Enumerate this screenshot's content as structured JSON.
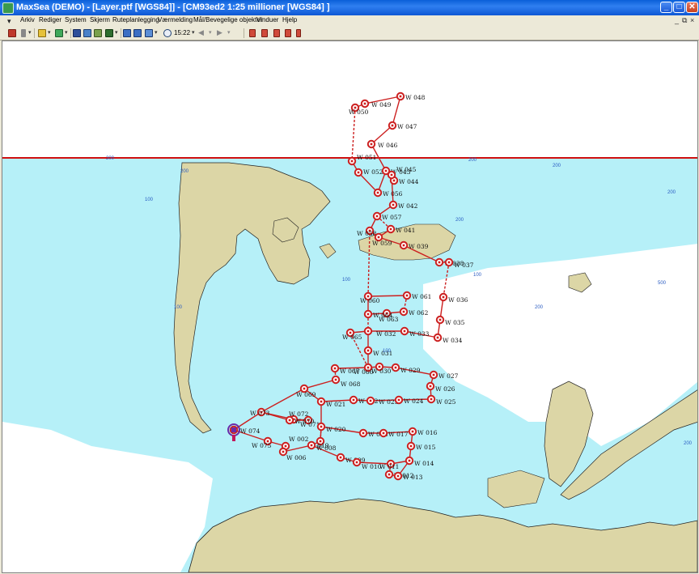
{
  "window": {
    "title": "MaxSea (DEMO) - [Layer.ptf [WGS84]] - [CM93ed2  1:25 millioner [WGS84] ]",
    "minimize_label": "_",
    "maximize_label": "□",
    "close_label": "✕"
  },
  "menu": {
    "items": [
      {
        "label": "Arkiv"
      },
      {
        "label": "Rediger"
      },
      {
        "label": "System"
      },
      {
        "label": "Skjerm"
      },
      {
        "label": "Ruteplanlegging"
      },
      {
        "label": "Værmelding"
      },
      {
        "label": "Mål/Bevegelige objekter"
      },
      {
        "label": "Vinduer"
      },
      {
        "label": "Hjelp"
      }
    ],
    "mdi_controls": [
      "_",
      "⧉",
      "×"
    ]
  },
  "toolbar": {
    "clock": "15:22"
  },
  "colors": {
    "sea": "#b6f0f8",
    "land": "#dcd6a6",
    "route": "#cc1f1f",
    "depth_label": "#2a5cc2"
  },
  "map": {
    "waypoints": [
      {
        "label": "W 048"
      },
      {
        "label": "W 049"
      },
      {
        "label": "W 050"
      },
      {
        "label": "W 047"
      },
      {
        "label": "W 046"
      },
      {
        "label": "W 051"
      },
      {
        "label": "W 052"
      },
      {
        "label": "W 043"
      },
      {
        "label": "W 044"
      },
      {
        "label": "W 045"
      },
      {
        "label": "W 056"
      },
      {
        "label": "W 042"
      },
      {
        "label": "W 057"
      },
      {
        "label": "W 041"
      },
      {
        "label": "W 058"
      },
      {
        "label": "W 059"
      },
      {
        "label": "W 039"
      },
      {
        "label": "W 038"
      },
      {
        "label": "W 037"
      },
      {
        "label": "W 036"
      },
      {
        "label": "W 061"
      },
      {
        "label": "W 060"
      },
      {
        "label": "W 062"
      },
      {
        "label": "W 063"
      },
      {
        "label": "W 064"
      },
      {
        "label": "W 035"
      },
      {
        "label": "W 032"
      },
      {
        "label": "W 033"
      },
      {
        "label": "W 034"
      },
      {
        "label": "W 065"
      },
      {
        "label": "W 031"
      },
      {
        "label": "W 030"
      },
      {
        "label": "W 029"
      },
      {
        "label": "W 027"
      },
      {
        "label": "W 066"
      },
      {
        "label": "W 067"
      },
      {
        "label": "W 068"
      },
      {
        "label": "W 026"
      },
      {
        "label": "W 069"
      },
      {
        "label": "W 022"
      },
      {
        "label": "W 023"
      },
      {
        "label": "W 024"
      },
      {
        "label": "W 025"
      },
      {
        "label": "W 021"
      },
      {
        "label": "W 073"
      },
      {
        "label": "W 072"
      },
      {
        "label": "W 071"
      },
      {
        "label": "W 070"
      },
      {
        "label": "W 020"
      },
      {
        "label": "W 018"
      },
      {
        "label": "W 017"
      },
      {
        "label": "W 016"
      },
      {
        "label": "W 074"
      },
      {
        "label": "W 075"
      },
      {
        "label": "W 019"
      },
      {
        "label": "W 002"
      },
      {
        "label": "W 015"
      },
      {
        "label": "W 008"
      },
      {
        "label": "W 006"
      },
      {
        "label": "W 014"
      },
      {
        "label": "W 009"
      },
      {
        "label": "W 010"
      },
      {
        "label": "W 011"
      },
      {
        "label": "W 012"
      },
      {
        "label": "W 013"
      }
    ],
    "depth_labels": [
      "200",
      "200",
      "200",
      "200",
      "200",
      "100",
      "100",
      "100",
      "200",
      "100",
      "500",
      "100",
      "200",
      "200"
    ]
  }
}
